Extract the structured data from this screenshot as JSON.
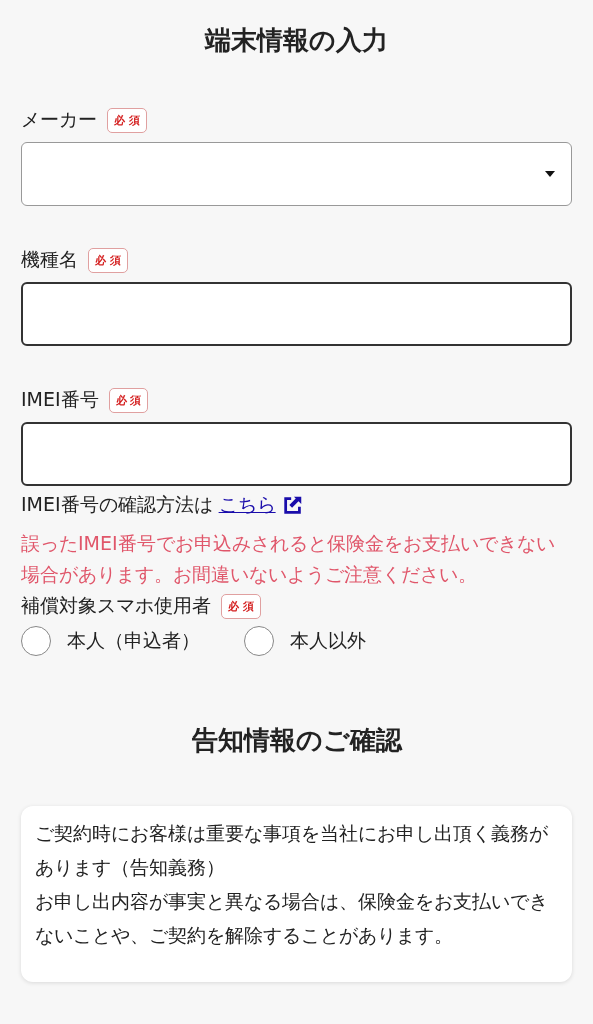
{
  "title": "端末情報の入力",
  "fields": [
    {
      "kind": "select",
      "label": "メーカー",
      "badge": "必 須"
    },
    {
      "kind": "text",
      "label": "機種名",
      "badge": "必 須"
    },
    {
      "kind": "text",
      "label": "IMEI番号",
      "badge": "必 須"
    }
  ],
  "imei_help": {
    "text": "IMEI番号の確認方法は",
    "link": "こちら"
  },
  "warning": "誤ったIMEI番号でお申込みされると保険金をお支払いできない場合があります。お間違いないようご注意ください。",
  "user_group": {
    "label": "補償対象スマホ使用者",
    "badge": "必 須",
    "options": [
      {
        "label": "本人（申込者）",
        "selected": false
      },
      {
        "label": "本人以外",
        "selected": false
      }
    ]
  },
  "notice": {
    "title": "告知情報のご確認",
    "paragraphs": [
      "ご契約時にお客様は重要な事項を当社にお申し出頂く義務があります（告知義務）",
      "お申し出内容が事実と異なる場合は、保険金をお支払いできないことや、ご契約を解除することがあります。"
    ]
  }
}
